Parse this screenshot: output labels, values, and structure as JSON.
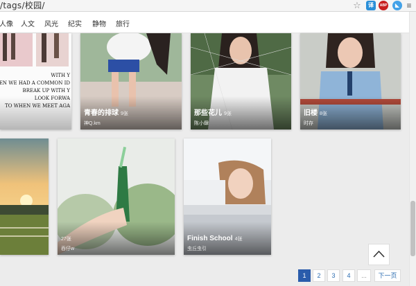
{
  "browser": {
    "url": "/tags/校园/",
    "ext_a": "译",
    "ext_b": "ABP",
    "ext_c": "◣",
    "menu": "≡",
    "star": "☆"
  },
  "nav": [
    "人像",
    "人文",
    "风光",
    "纪实",
    "静物",
    "旅行"
  ],
  "row1": [
    {
      "title": "",
      "count": "",
      "author": "",
      "poster_lines": [
        "WITH Y",
        "HEN WE HAD A COMMON ID",
        "BREAK UP WITH Y",
        "LOOK FORWA",
        "TO WHEN WE MEET AGA"
      ]
    },
    {
      "title": "青春的排球",
      "count": "9张",
      "author": "神Q.km"
    },
    {
      "title": "那些花儿",
      "count": "9张",
      "author": "陈小肆"
    },
    {
      "title": "旧楼",
      "count": "8张",
      "author": "时存"
    }
  ],
  "row2": [
    {
      "title": "",
      "count": "",
      "author": ""
    },
    {
      "title": "",
      "count": "27张",
      "author": "吞仔w"
    },
    {
      "title": "Finish School",
      "count": "4张",
      "author": "虫丘虫引"
    }
  ],
  "pagination": {
    "pages": [
      "1",
      "2",
      "3",
      "4",
      "..."
    ],
    "next": "下一页",
    "active": "1"
  },
  "colors": {
    "accent": "#2a5cab"
  }
}
